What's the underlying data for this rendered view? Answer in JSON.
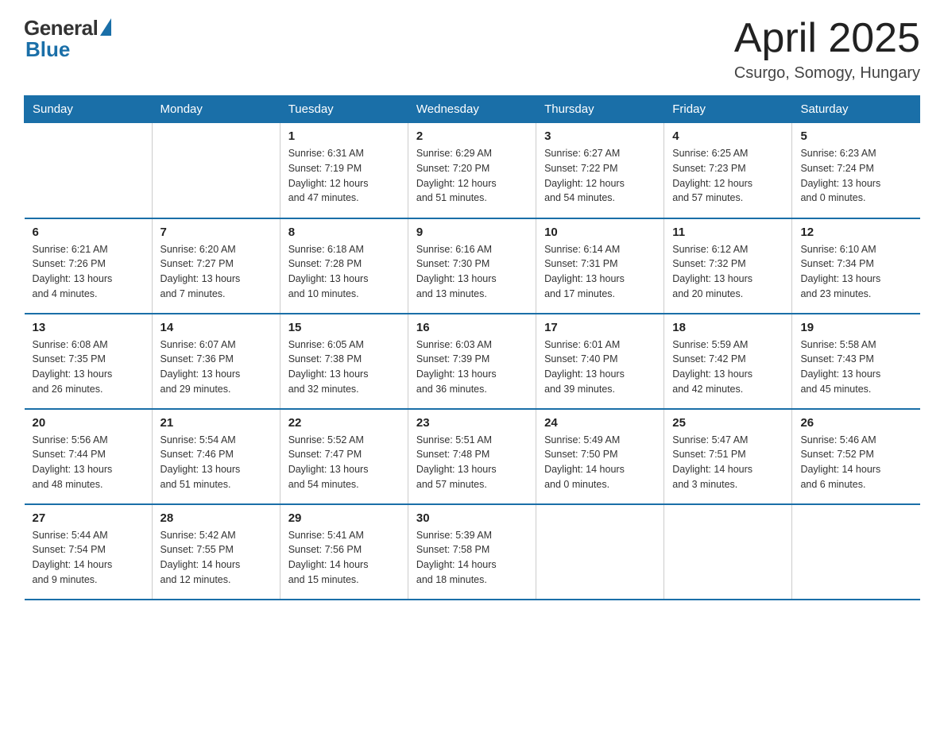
{
  "logo": {
    "general": "General",
    "blue": "Blue"
  },
  "title": "April 2025",
  "location": "Csurgo, Somogy, Hungary",
  "headers": [
    "Sunday",
    "Monday",
    "Tuesday",
    "Wednesday",
    "Thursday",
    "Friday",
    "Saturday"
  ],
  "rows": [
    [
      {
        "day": "",
        "info": ""
      },
      {
        "day": "",
        "info": ""
      },
      {
        "day": "1",
        "info": "Sunrise: 6:31 AM\nSunset: 7:19 PM\nDaylight: 12 hours\nand 47 minutes."
      },
      {
        "day": "2",
        "info": "Sunrise: 6:29 AM\nSunset: 7:20 PM\nDaylight: 12 hours\nand 51 minutes."
      },
      {
        "day": "3",
        "info": "Sunrise: 6:27 AM\nSunset: 7:22 PM\nDaylight: 12 hours\nand 54 minutes."
      },
      {
        "day": "4",
        "info": "Sunrise: 6:25 AM\nSunset: 7:23 PM\nDaylight: 12 hours\nand 57 minutes."
      },
      {
        "day": "5",
        "info": "Sunrise: 6:23 AM\nSunset: 7:24 PM\nDaylight: 13 hours\nand 0 minutes."
      }
    ],
    [
      {
        "day": "6",
        "info": "Sunrise: 6:21 AM\nSunset: 7:26 PM\nDaylight: 13 hours\nand 4 minutes."
      },
      {
        "day": "7",
        "info": "Sunrise: 6:20 AM\nSunset: 7:27 PM\nDaylight: 13 hours\nand 7 minutes."
      },
      {
        "day": "8",
        "info": "Sunrise: 6:18 AM\nSunset: 7:28 PM\nDaylight: 13 hours\nand 10 minutes."
      },
      {
        "day": "9",
        "info": "Sunrise: 6:16 AM\nSunset: 7:30 PM\nDaylight: 13 hours\nand 13 minutes."
      },
      {
        "day": "10",
        "info": "Sunrise: 6:14 AM\nSunset: 7:31 PM\nDaylight: 13 hours\nand 17 minutes."
      },
      {
        "day": "11",
        "info": "Sunrise: 6:12 AM\nSunset: 7:32 PM\nDaylight: 13 hours\nand 20 minutes."
      },
      {
        "day": "12",
        "info": "Sunrise: 6:10 AM\nSunset: 7:34 PM\nDaylight: 13 hours\nand 23 minutes."
      }
    ],
    [
      {
        "day": "13",
        "info": "Sunrise: 6:08 AM\nSunset: 7:35 PM\nDaylight: 13 hours\nand 26 minutes."
      },
      {
        "day": "14",
        "info": "Sunrise: 6:07 AM\nSunset: 7:36 PM\nDaylight: 13 hours\nand 29 minutes."
      },
      {
        "day": "15",
        "info": "Sunrise: 6:05 AM\nSunset: 7:38 PM\nDaylight: 13 hours\nand 32 minutes."
      },
      {
        "day": "16",
        "info": "Sunrise: 6:03 AM\nSunset: 7:39 PM\nDaylight: 13 hours\nand 36 minutes."
      },
      {
        "day": "17",
        "info": "Sunrise: 6:01 AM\nSunset: 7:40 PM\nDaylight: 13 hours\nand 39 minutes."
      },
      {
        "day": "18",
        "info": "Sunrise: 5:59 AM\nSunset: 7:42 PM\nDaylight: 13 hours\nand 42 minutes."
      },
      {
        "day": "19",
        "info": "Sunrise: 5:58 AM\nSunset: 7:43 PM\nDaylight: 13 hours\nand 45 minutes."
      }
    ],
    [
      {
        "day": "20",
        "info": "Sunrise: 5:56 AM\nSunset: 7:44 PM\nDaylight: 13 hours\nand 48 minutes."
      },
      {
        "day": "21",
        "info": "Sunrise: 5:54 AM\nSunset: 7:46 PM\nDaylight: 13 hours\nand 51 minutes."
      },
      {
        "day": "22",
        "info": "Sunrise: 5:52 AM\nSunset: 7:47 PM\nDaylight: 13 hours\nand 54 minutes."
      },
      {
        "day": "23",
        "info": "Sunrise: 5:51 AM\nSunset: 7:48 PM\nDaylight: 13 hours\nand 57 minutes."
      },
      {
        "day": "24",
        "info": "Sunrise: 5:49 AM\nSunset: 7:50 PM\nDaylight: 14 hours\nand 0 minutes."
      },
      {
        "day": "25",
        "info": "Sunrise: 5:47 AM\nSunset: 7:51 PM\nDaylight: 14 hours\nand 3 minutes."
      },
      {
        "day": "26",
        "info": "Sunrise: 5:46 AM\nSunset: 7:52 PM\nDaylight: 14 hours\nand 6 minutes."
      }
    ],
    [
      {
        "day": "27",
        "info": "Sunrise: 5:44 AM\nSunset: 7:54 PM\nDaylight: 14 hours\nand 9 minutes."
      },
      {
        "day": "28",
        "info": "Sunrise: 5:42 AM\nSunset: 7:55 PM\nDaylight: 14 hours\nand 12 minutes."
      },
      {
        "day": "29",
        "info": "Sunrise: 5:41 AM\nSunset: 7:56 PM\nDaylight: 14 hours\nand 15 minutes."
      },
      {
        "day": "30",
        "info": "Sunrise: 5:39 AM\nSunset: 7:58 PM\nDaylight: 14 hours\nand 18 minutes."
      },
      {
        "day": "",
        "info": ""
      },
      {
        "day": "",
        "info": ""
      },
      {
        "day": "",
        "info": ""
      }
    ]
  ]
}
